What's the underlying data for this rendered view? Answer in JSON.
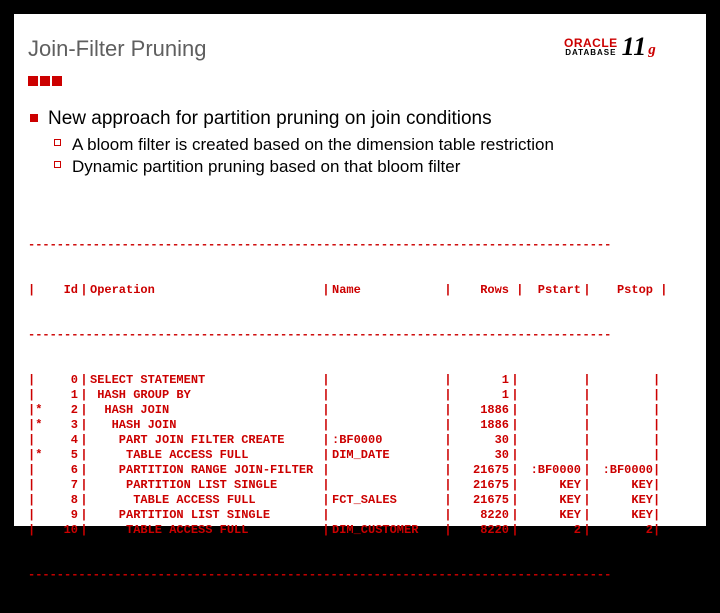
{
  "title": "Join-Filter Pruning",
  "logo": {
    "brand_top": "ORACLE",
    "brand_bottom": "DATABASE",
    "ver_num": "11",
    "ver_suffix": "g"
  },
  "bullets": {
    "l1": "New approach for partition pruning on join conditions",
    "l2a": "A bloom filter is created based on the dimension table restriction",
    "l2b": "Dynamic partition pruning based on that bloom filter"
  },
  "plan": {
    "sep": "---------------------------------------------------------------------------------",
    "hdr": {
      "mark": "|",
      "id": "Id",
      "op": "Operation",
      "name": "Name",
      "rows": "Rows",
      "pstart": "Pstart",
      "pstop": "Pstop"
    },
    "rows": [
      {
        "mark": "| ",
        "id": "0",
        "op": "SELECT STATEMENT",
        "name": "",
        "rows": "1",
        "pstart": "",
        "pstop": ""
      },
      {
        "mark": "| ",
        "id": "1",
        "op": " HASH GROUP BY",
        "name": "",
        "rows": "1",
        "pstart": "",
        "pstop": ""
      },
      {
        "mark": "|*",
        "id": "2",
        "op": "  HASH JOIN",
        "name": "",
        "rows": "1886",
        "pstart": "",
        "pstop": ""
      },
      {
        "mark": "|*",
        "id": "3",
        "op": "   HASH JOIN",
        "name": "",
        "rows": "1886",
        "pstart": "",
        "pstop": ""
      },
      {
        "mark": "| ",
        "id": "4",
        "op": "    PART JOIN FILTER CREATE",
        "name": ":BF0000",
        "rows": "30",
        "pstart": "",
        "pstop": ""
      },
      {
        "mark": "|*",
        "id": "5",
        "op": "     TABLE ACCESS FULL",
        "name": "DIM_DATE",
        "rows": "30",
        "pstart": "",
        "pstop": ""
      },
      {
        "mark": "| ",
        "id": "6",
        "op": "    PARTITION RANGE JOIN-FILTER",
        "name": "",
        "rows": "21675",
        "pstart": ":BF0000",
        "pstop": ":BF0000"
      },
      {
        "mark": "| ",
        "id": "7",
        "op": "     PARTITION LIST SINGLE",
        "name": "",
        "rows": "21675",
        "pstart": "KEY",
        "pstop": "KEY"
      },
      {
        "mark": "| ",
        "id": "8",
        "op": "      TABLE ACCESS FULL",
        "name": "FCT_SALES",
        "rows": "21675",
        "pstart": "KEY",
        "pstop": "KEY"
      },
      {
        "mark": "| ",
        "id": "9",
        "op": "    PARTITION LIST SINGLE",
        "name": "",
        "rows": "8220",
        "pstart": "KEY",
        "pstop": "KEY"
      },
      {
        "mark": "| ",
        "id": "10",
        "op": "     TABLE ACCESS FULL",
        "name": "DIM_CUSTOMER",
        "rows": "8220",
        "pstart": "2",
        "pstop": "2"
      }
    ]
  }
}
